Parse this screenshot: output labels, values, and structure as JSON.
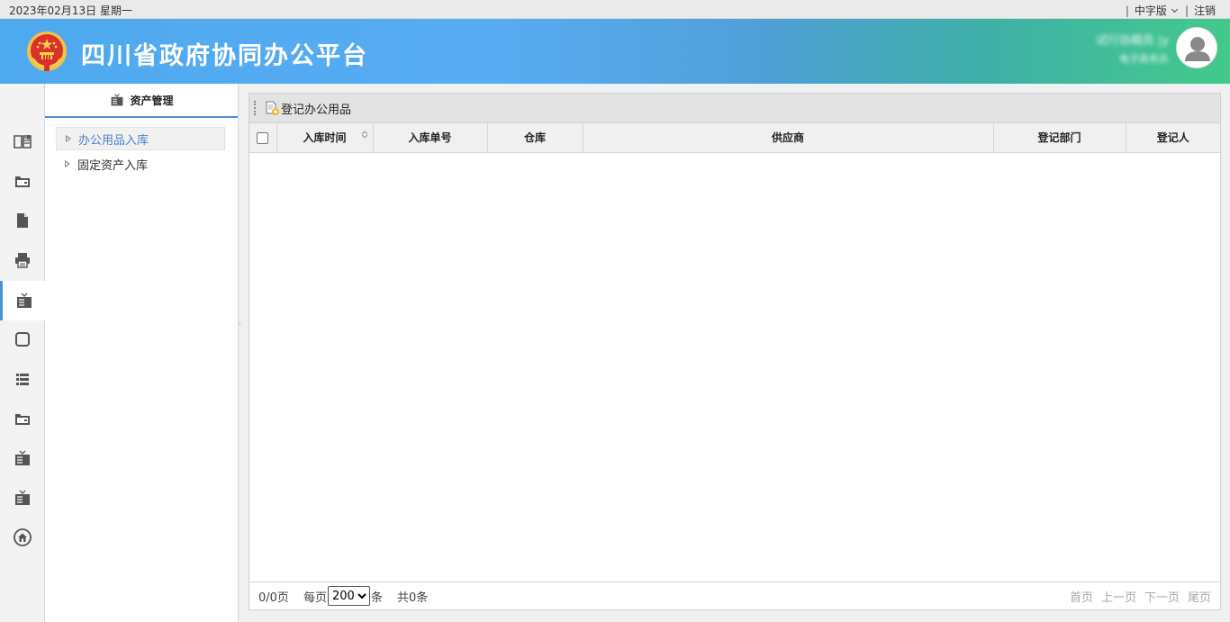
{
  "topbar": {
    "date": "2023年02月13日 星期一",
    "language": "中字版",
    "logout": "注销",
    "separator": "|"
  },
  "header": {
    "title": "四川省政府协同办公平台",
    "user_name": "试行协稿员 |y",
    "user_dept": "电子政务办"
  },
  "rail": {
    "items": [
      {
        "icon": "book-icon"
      },
      {
        "icon": "archive-icon"
      },
      {
        "icon": "document-icon"
      },
      {
        "icon": "printer-icon"
      },
      {
        "icon": "asset-icon",
        "active": true
      },
      {
        "icon": "square-icon"
      },
      {
        "icon": "list-icon"
      },
      {
        "icon": "archive-icon"
      },
      {
        "icon": "asset-icon"
      },
      {
        "icon": "asset-icon"
      },
      {
        "icon": "home-icon"
      }
    ]
  },
  "subnav": {
    "header": "资产管理",
    "items": [
      {
        "label": "办公用品入库",
        "active": true
      },
      {
        "label": "固定资产入库",
        "active": false
      }
    ]
  },
  "toolbar": {
    "register_label": "登记办公用品"
  },
  "table": {
    "columns": [
      "入库时间",
      "入库单号",
      "仓库",
      "供应商",
      "登记部门",
      "登记人"
    ],
    "rows": []
  },
  "pager": {
    "page_info": "0/0页",
    "per_page_prefix": "每页",
    "per_page_value": "200",
    "per_page_options": [
      "200"
    ],
    "per_page_suffix": "条",
    "total": "共0条",
    "first": "首页",
    "prev": "上一页",
    "next": "下一页",
    "last": "尾页"
  },
  "colors": {
    "accent": "#4a8fdc",
    "header_start": "#4ea9ef",
    "header_end": "#43c98b"
  }
}
